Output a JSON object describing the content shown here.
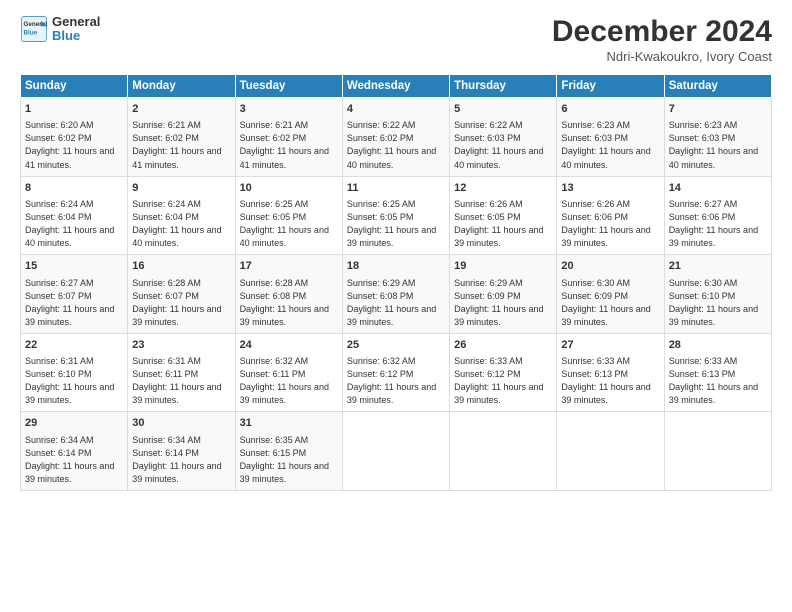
{
  "header": {
    "logo_general": "General",
    "logo_blue": "Blue",
    "title": "December 2024",
    "subtitle": "Ndri-Kwakoukro, Ivory Coast"
  },
  "days_of_week": [
    "Sunday",
    "Monday",
    "Tuesday",
    "Wednesday",
    "Thursday",
    "Friday",
    "Saturday"
  ],
  "weeks": [
    [
      {
        "day": "1",
        "sunrise": "6:20 AM",
        "sunset": "6:02 PM",
        "daylight": "11 hours and 41 minutes."
      },
      {
        "day": "2",
        "sunrise": "6:21 AM",
        "sunset": "6:02 PM",
        "daylight": "11 hours and 41 minutes."
      },
      {
        "day": "3",
        "sunrise": "6:21 AM",
        "sunset": "6:02 PM",
        "daylight": "11 hours and 41 minutes."
      },
      {
        "day": "4",
        "sunrise": "6:22 AM",
        "sunset": "6:02 PM",
        "daylight": "11 hours and 40 minutes."
      },
      {
        "day": "5",
        "sunrise": "6:22 AM",
        "sunset": "6:03 PM",
        "daylight": "11 hours and 40 minutes."
      },
      {
        "day": "6",
        "sunrise": "6:23 AM",
        "sunset": "6:03 PM",
        "daylight": "11 hours and 40 minutes."
      },
      {
        "day": "7",
        "sunrise": "6:23 AM",
        "sunset": "6:03 PM",
        "daylight": "11 hours and 40 minutes."
      }
    ],
    [
      {
        "day": "8",
        "sunrise": "6:24 AM",
        "sunset": "6:04 PM",
        "daylight": "11 hours and 40 minutes."
      },
      {
        "day": "9",
        "sunrise": "6:24 AM",
        "sunset": "6:04 PM",
        "daylight": "11 hours and 40 minutes."
      },
      {
        "day": "10",
        "sunrise": "6:25 AM",
        "sunset": "6:05 PM",
        "daylight": "11 hours and 40 minutes."
      },
      {
        "day": "11",
        "sunrise": "6:25 AM",
        "sunset": "6:05 PM",
        "daylight": "11 hours and 39 minutes."
      },
      {
        "day": "12",
        "sunrise": "6:26 AM",
        "sunset": "6:05 PM",
        "daylight": "11 hours and 39 minutes."
      },
      {
        "day": "13",
        "sunrise": "6:26 AM",
        "sunset": "6:06 PM",
        "daylight": "11 hours and 39 minutes."
      },
      {
        "day": "14",
        "sunrise": "6:27 AM",
        "sunset": "6:06 PM",
        "daylight": "11 hours and 39 minutes."
      }
    ],
    [
      {
        "day": "15",
        "sunrise": "6:27 AM",
        "sunset": "6:07 PM",
        "daylight": "11 hours and 39 minutes."
      },
      {
        "day": "16",
        "sunrise": "6:28 AM",
        "sunset": "6:07 PM",
        "daylight": "11 hours and 39 minutes."
      },
      {
        "day": "17",
        "sunrise": "6:28 AM",
        "sunset": "6:08 PM",
        "daylight": "11 hours and 39 minutes."
      },
      {
        "day": "18",
        "sunrise": "6:29 AM",
        "sunset": "6:08 PM",
        "daylight": "11 hours and 39 minutes."
      },
      {
        "day": "19",
        "sunrise": "6:29 AM",
        "sunset": "6:09 PM",
        "daylight": "11 hours and 39 minutes."
      },
      {
        "day": "20",
        "sunrise": "6:30 AM",
        "sunset": "6:09 PM",
        "daylight": "11 hours and 39 minutes."
      },
      {
        "day": "21",
        "sunrise": "6:30 AM",
        "sunset": "6:10 PM",
        "daylight": "11 hours and 39 minutes."
      }
    ],
    [
      {
        "day": "22",
        "sunrise": "6:31 AM",
        "sunset": "6:10 PM",
        "daylight": "11 hours and 39 minutes."
      },
      {
        "day": "23",
        "sunrise": "6:31 AM",
        "sunset": "6:11 PM",
        "daylight": "11 hours and 39 minutes."
      },
      {
        "day": "24",
        "sunrise": "6:32 AM",
        "sunset": "6:11 PM",
        "daylight": "11 hours and 39 minutes."
      },
      {
        "day": "25",
        "sunrise": "6:32 AM",
        "sunset": "6:12 PM",
        "daylight": "11 hours and 39 minutes."
      },
      {
        "day": "26",
        "sunrise": "6:33 AM",
        "sunset": "6:12 PM",
        "daylight": "11 hours and 39 minutes."
      },
      {
        "day": "27",
        "sunrise": "6:33 AM",
        "sunset": "6:13 PM",
        "daylight": "11 hours and 39 minutes."
      },
      {
        "day": "28",
        "sunrise": "6:33 AM",
        "sunset": "6:13 PM",
        "daylight": "11 hours and 39 minutes."
      }
    ],
    [
      {
        "day": "29",
        "sunrise": "6:34 AM",
        "sunset": "6:14 PM",
        "daylight": "11 hours and 39 minutes."
      },
      {
        "day": "30",
        "sunrise": "6:34 AM",
        "sunset": "6:14 PM",
        "daylight": "11 hours and 39 minutes."
      },
      {
        "day": "31",
        "sunrise": "6:35 AM",
        "sunset": "6:15 PM",
        "daylight": "11 hours and 39 minutes."
      },
      null,
      null,
      null,
      null
    ]
  ],
  "labels": {
    "sunrise": "Sunrise:",
    "sunset": "Sunset:",
    "daylight": "Daylight:"
  }
}
